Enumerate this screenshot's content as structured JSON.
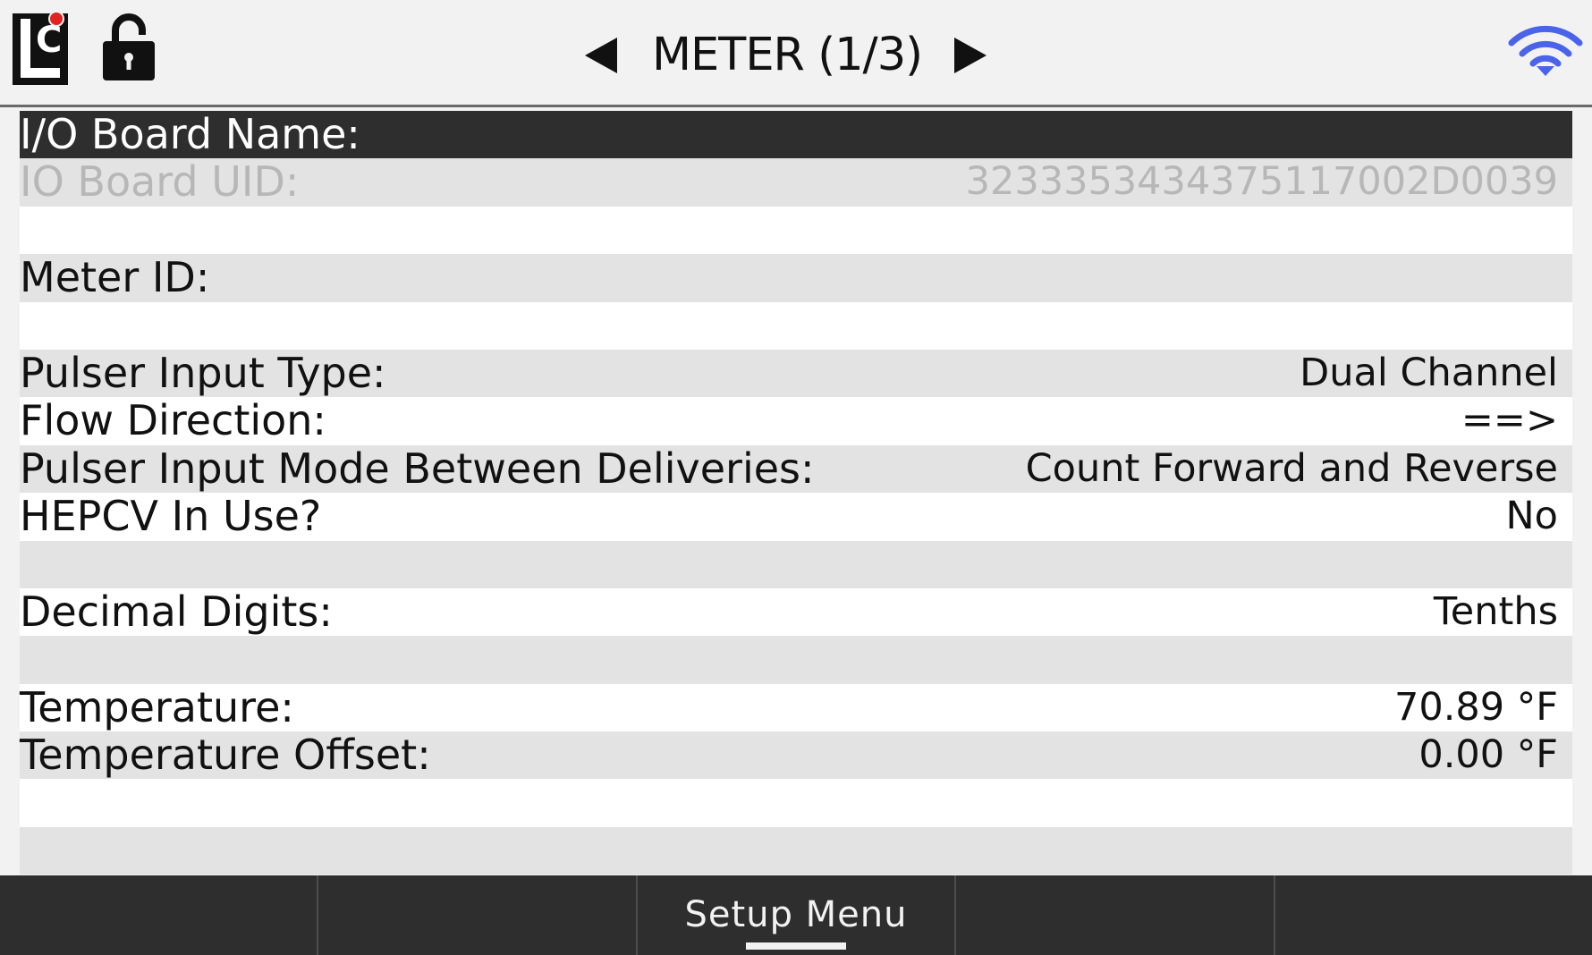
{
  "header": {
    "logo_text": "LC",
    "title": "METER (1/3)"
  },
  "rows": [
    {
      "label": "I/O Board Name:",
      "value": ""
    },
    {
      "label": "IO Board UID:",
      "value": "3233353434375117002D0039"
    },
    {
      "label": "",
      "value": ""
    },
    {
      "label": "Meter ID:",
      "value": ""
    },
    {
      "label": "",
      "value": ""
    },
    {
      "label": "Pulser Input Type:",
      "value": "Dual Channel"
    },
    {
      "label": "Flow Direction:",
      "value": "==>"
    },
    {
      "label": "Pulser Input Mode Between Deliveries:",
      "value": "Count Forward and Reverse"
    },
    {
      "label": "HEPCV In Use?",
      "value": "No"
    },
    {
      "label": "",
      "value": ""
    },
    {
      "label": "Decimal Digits:",
      "value": "Tenths"
    },
    {
      "label": "",
      "value": ""
    },
    {
      "label": "Temperature:",
      "value": "70.89 °F"
    },
    {
      "label": "Temperature Offset:",
      "value": "0.00 °F"
    },
    {
      "label": "",
      "value": ""
    },
    {
      "label": "",
      "value": ""
    }
  ],
  "footer": {
    "buttons": [
      "",
      "",
      "Setup Menu",
      "",
      ""
    ]
  },
  "colors": {
    "selected_row": "#2e2e2e",
    "stripe": "#e3e3e3",
    "wifi": "#4a63e8",
    "logo_dot": "#e32222"
  }
}
